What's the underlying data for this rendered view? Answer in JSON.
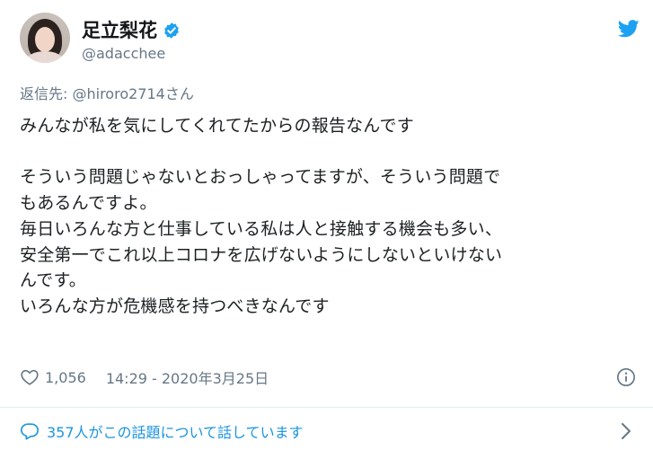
{
  "user": {
    "display_name": "足立梨花",
    "handle": "@adacchee",
    "verified": true
  },
  "reply": {
    "prefix": "返信先: ",
    "mention": "@hiroro2714さん"
  },
  "tweet": {
    "text": "みんなが私を気にしてくれてたからの報告なんです\n\nそういう問題じゃないとおっしゃってますが、そういう問題で\nもあるんですよ。\n毎日いろんな方と仕事している私は人と接触する機会も多い、\n安全第一でこれ以上コロナを広げないようにしないといけない\nんです。\nいろんな方が危機感を持つべきなんです"
  },
  "meta": {
    "like_count": "1,056",
    "timestamp": "14:29 - 2020年3月25日"
  },
  "conversation": {
    "label": "357人がこの話題について話しています"
  },
  "icons": {
    "verified": "verified-badge-icon",
    "logo": "twitter-bird-icon",
    "like": "heart-icon",
    "info": "info-icon",
    "comment": "speech-bubble-icon",
    "chevron": "chevron-right-icon"
  },
  "colors": {
    "twitter_blue": "#1da1f2",
    "link_blue": "#1b95e0",
    "secondary_text": "#657786",
    "primary_text": "#14171a",
    "divider": "#e6ecf0"
  }
}
